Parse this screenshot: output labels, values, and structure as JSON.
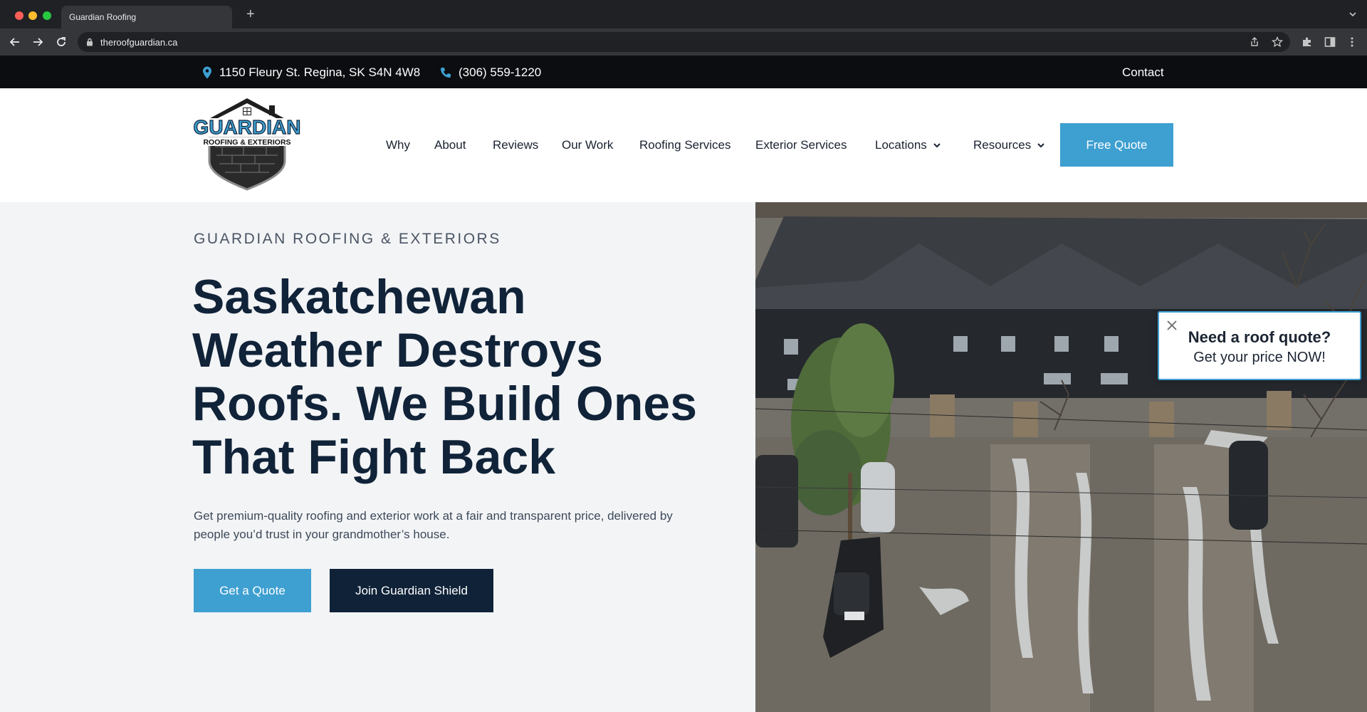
{
  "browser": {
    "tab_title": "Guardian Roofing",
    "new_tab": "+",
    "url": "theroofguardian.ca"
  },
  "infobar": {
    "address": "1150 Fleury St. Regina, SK S4N 4W8",
    "phone": "(306) 559-1220",
    "contact": "Contact"
  },
  "logo": {
    "line1": "GUARDIAN",
    "line2": "ROOFING & EXTERIORS"
  },
  "nav": {
    "items": [
      "Why",
      "About",
      "Reviews",
      "Our Work",
      "Roofing Services",
      "Exterior Services",
      "Locations",
      "Resources"
    ],
    "cta": "Free Quote"
  },
  "hero": {
    "eyebrow": "GUARDIAN ROOFING & EXTERIORS",
    "headline": "Saskatchewan Weather Destroys Roofs. We Build Ones That Fight Back",
    "lead": "Get premium-quality roofing and exterior work at a fair and transparent price, delivered by people you’d trust in your grandmother’s house.",
    "primary_button": "Get a Quote",
    "secondary_button": "Join Guardian Shield"
  },
  "popup": {
    "title": "Need a roof quote?",
    "subtitle": "Get your price NOW!"
  },
  "colors": {
    "accent": "#3e9fd1",
    "navy": "#0f2238",
    "topbar": "#0b0d10",
    "hero_bg": "#f3f4f6"
  },
  "icons": [
    "location-pin-icon",
    "phone-icon",
    "chevron-down-icon",
    "close-icon",
    "lock-icon",
    "back-icon",
    "forward-icon",
    "reload-icon",
    "share-icon",
    "star-icon",
    "extensions-icon",
    "sidebar-icon",
    "menu-icon"
  ]
}
